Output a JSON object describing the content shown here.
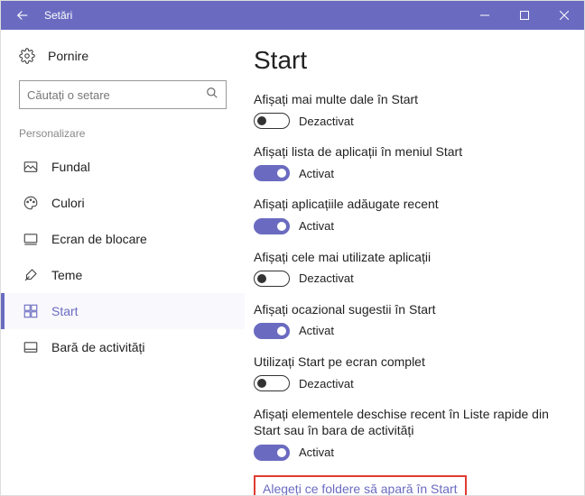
{
  "titlebar": {
    "title": "Setări"
  },
  "sidebar": {
    "power_label": "Pornire",
    "search_placeholder": "Căutați o setare",
    "section": "Personalizare",
    "items": [
      {
        "label": "Fundal"
      },
      {
        "label": "Culori"
      },
      {
        "label": "Ecran de blocare"
      },
      {
        "label": "Teme"
      },
      {
        "label": "Start"
      },
      {
        "label": "Bară de activități"
      }
    ]
  },
  "main": {
    "title": "Start",
    "state_on": "Activat",
    "state_off": "Dezactivat",
    "settings": [
      {
        "label": "Afișați mai multe dale în Start",
        "on": false
      },
      {
        "label": "Afișați lista de aplicații în meniul Start",
        "on": true
      },
      {
        "label": "Afișați aplicațiile adăugate recent",
        "on": true
      },
      {
        "label": "Afișați cele mai utilizate aplicații",
        "on": false
      },
      {
        "label": "Afișați ocazional sugestii în Start",
        "on": true
      },
      {
        "label": "Utilizați Start pe ecran complet",
        "on": false
      },
      {
        "label": "Afișați elementele deschise recent în Liste rapide din Start sau în bara de activități",
        "on": true
      }
    ],
    "link": "Alegeți ce foldere să apară în Start"
  }
}
